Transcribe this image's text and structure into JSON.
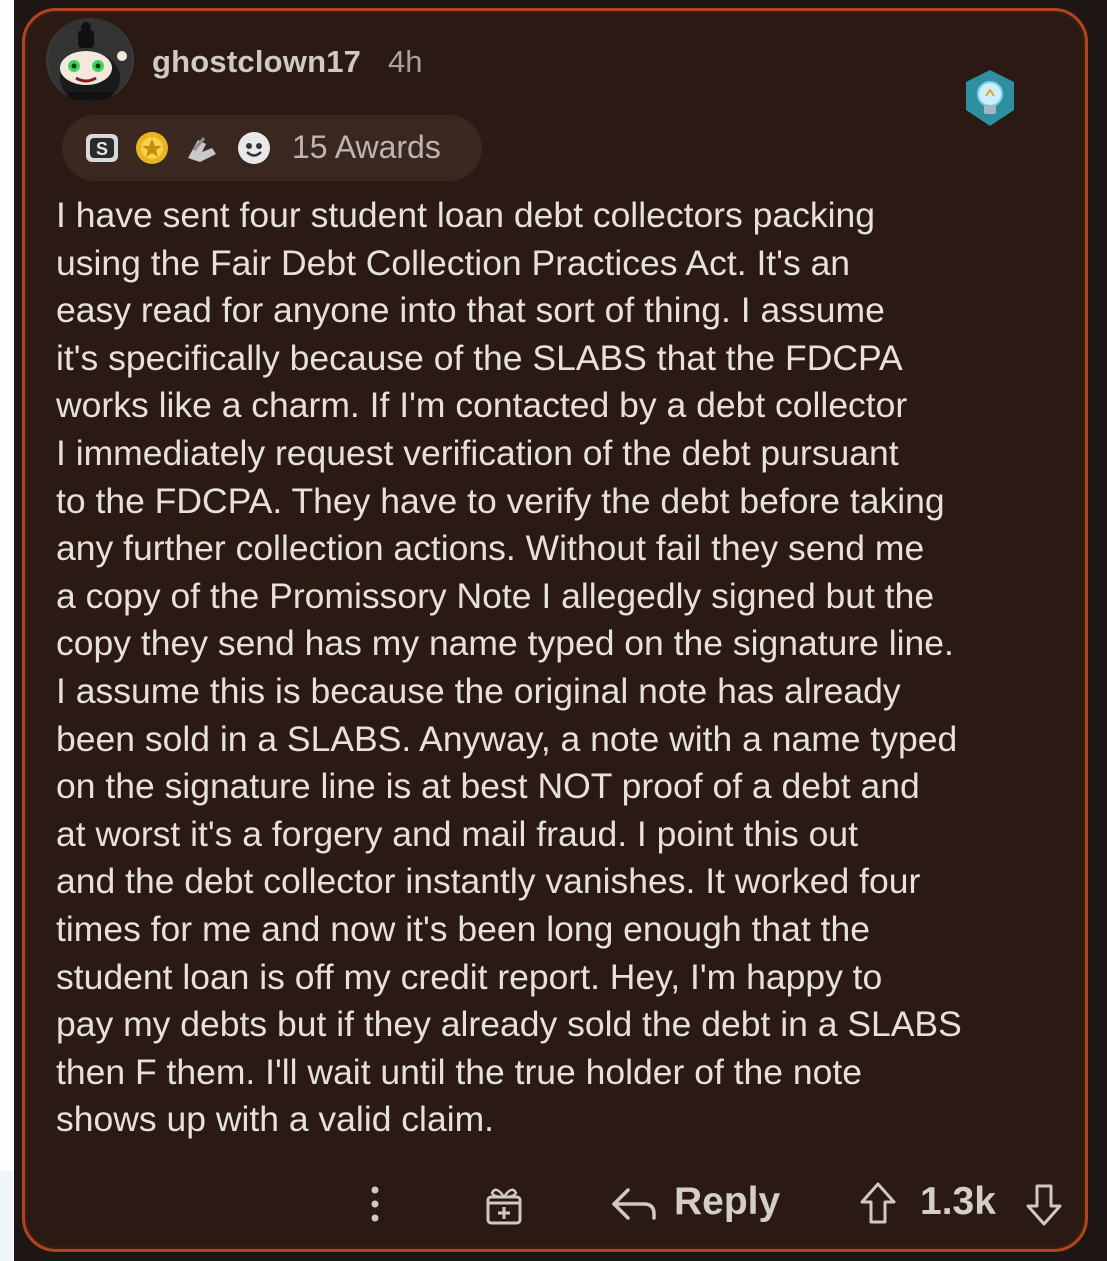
{
  "comment": {
    "username": "ghostclown17",
    "time": "4h",
    "awards_label": "15 Awards",
    "body": "I have sent four student loan debt collectors packing\nusing the Fair Debt Collection Practices Act. It's an\neasy read for anyone into that sort of thing. I assume\nit's specifically because of the SLABS that the FDCPA\nworks like a charm. If I'm contacted by a debt collector\nI immediately request verification of the debt pursuant\nto the FDCPA. They have to verify the debt before taking\nany further collection actions. Without fail they send me\na copy of the Promissory Note I allegedly signed but the\ncopy they send has my name typed on the signature line.\nI assume this is because the original note has already\nbeen sold in a SLABS. Anyway, a note with a name typed\non the signature line is at best NOT proof of a debt and\nat worst it's a forgery and mail fraud. I point this out\nand the debt collector instantly vanishes. It worked four\ntimes for me and now it's been long enough that the\nstudent loan is off my credit report. Hey, I'm happy to\npay my debts but if they already sold the debt in a SLABS\nthen F them. I'll wait until the true holder of the note\nshows up with a valid claim."
  },
  "toolbar": {
    "reply_label": "Reply",
    "score": "1.3k"
  },
  "icons": {
    "avatar": "snoo-avatar",
    "flair": "lightbulb-icon",
    "awards": [
      "silver-award-icon",
      "gold-award-icon",
      "helpful-hands-award-icon",
      "wholesome-award-icon"
    ],
    "toolbar": [
      "more-options-icon",
      "gift-award-icon",
      "reply-arrow-icon",
      "upvote-icon",
      "downvote-icon"
    ]
  },
  "colors": {
    "card_background": "#2a1a13",
    "card_border": "#b0441c",
    "text": "#e6e1dc",
    "muted_text": "#a9a29c"
  }
}
